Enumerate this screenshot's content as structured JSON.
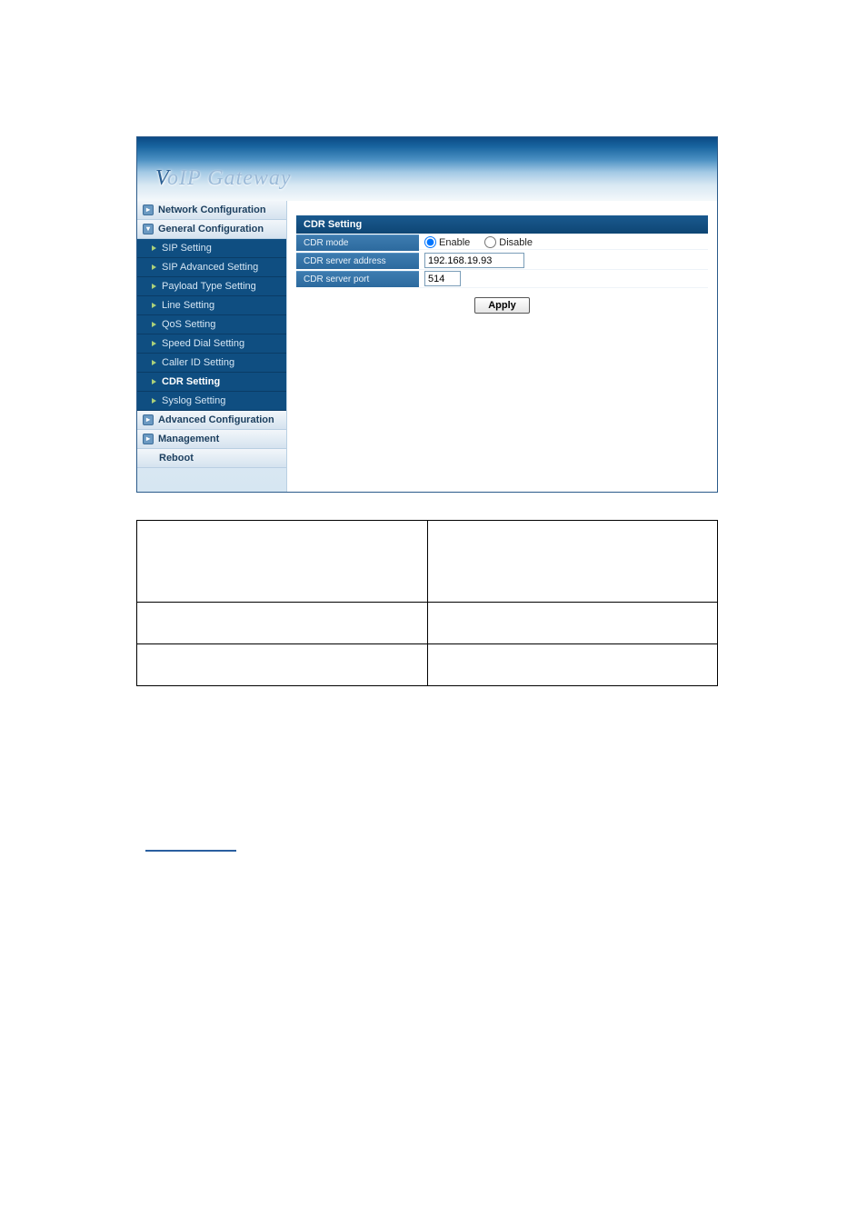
{
  "banner": {
    "title_v": "V",
    "title_rest": "oIP  Gateway"
  },
  "sidebar": {
    "sections": [
      {
        "label": "Network Configuration",
        "type": "header",
        "icon": "right"
      },
      {
        "label": "General Configuration",
        "type": "header",
        "icon": "down"
      },
      {
        "label": "SIP Setting",
        "type": "sub"
      },
      {
        "label": "SIP Advanced Setting",
        "type": "sub"
      },
      {
        "label": "Payload Type Setting",
        "type": "sub"
      },
      {
        "label": "Line Setting",
        "type": "sub"
      },
      {
        "label": "QoS Setting",
        "type": "sub"
      },
      {
        "label": "Speed Dial Setting",
        "type": "sub"
      },
      {
        "label": "Caller ID Setting",
        "type": "sub"
      },
      {
        "label": "CDR Setting",
        "type": "sub"
      },
      {
        "label": "Syslog Setting",
        "type": "sub"
      },
      {
        "label": "Advanced Configuration",
        "type": "header",
        "icon": "right"
      },
      {
        "label": "Management",
        "type": "header",
        "icon": "right"
      },
      {
        "label": "Reboot",
        "type": "reboot"
      }
    ]
  },
  "panel": {
    "title": "CDR Setting",
    "rows": {
      "mode": {
        "label": "CDR mode",
        "enable": "Enable",
        "disable": "Disable",
        "value": "enable"
      },
      "addr": {
        "label": "CDR server address",
        "value": "192.168.19.93"
      },
      "port": {
        "label": "CDR server port",
        "value": "514"
      }
    },
    "apply": "Apply"
  }
}
